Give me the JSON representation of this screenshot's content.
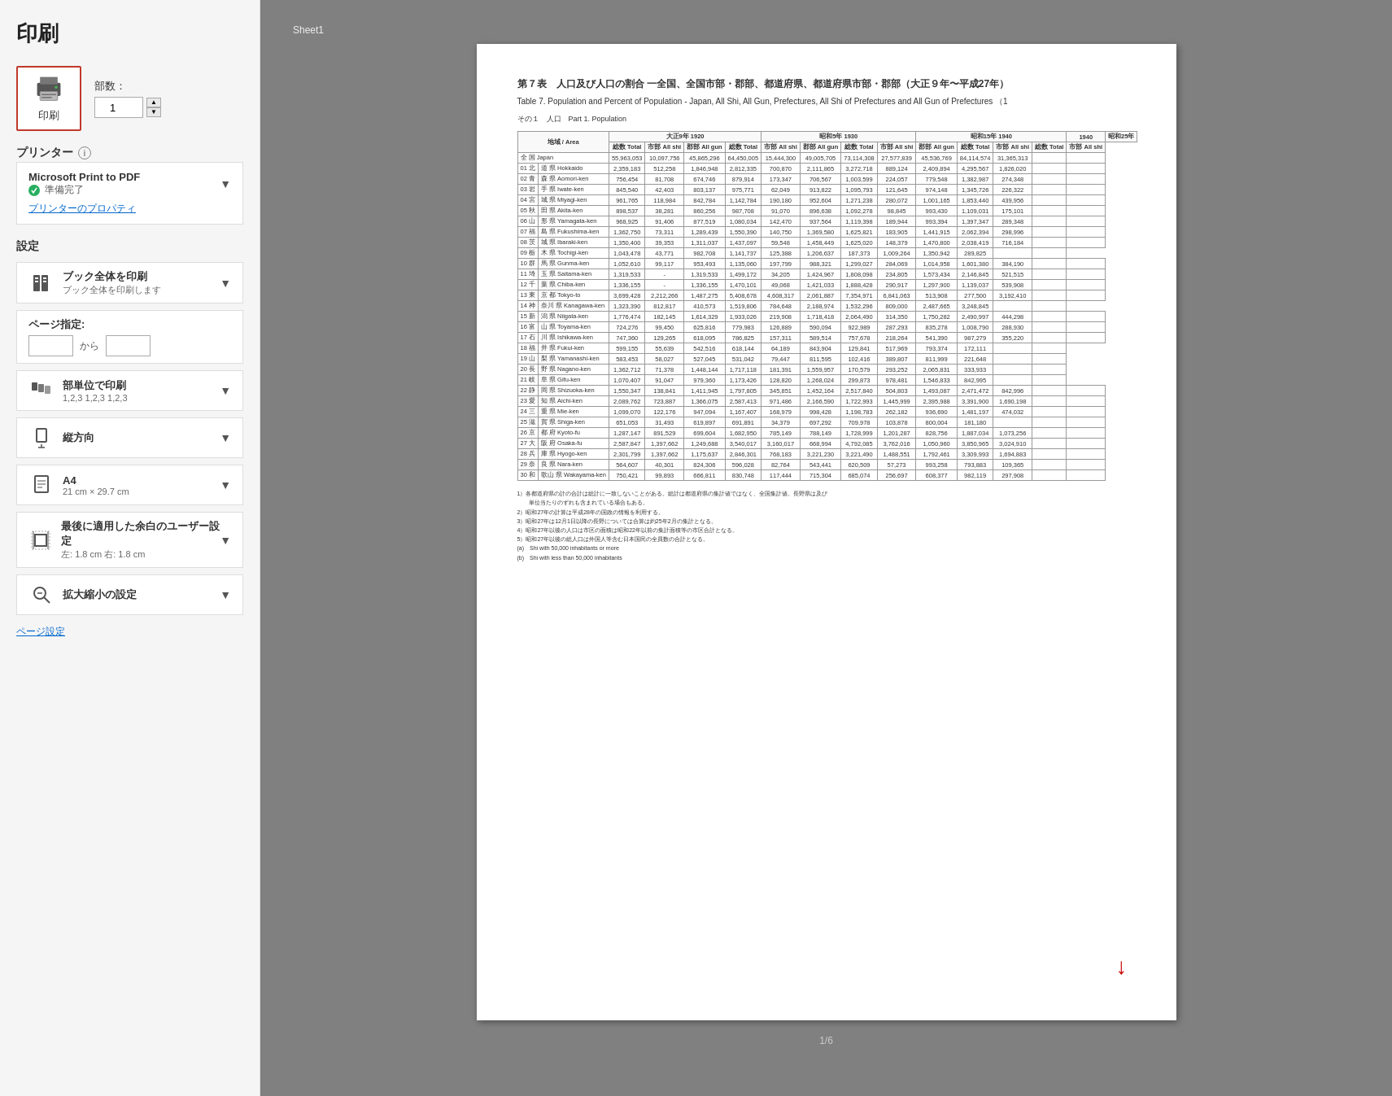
{
  "page": {
    "title": "印刷",
    "print_button_label": "印刷"
  },
  "copies": {
    "label": "部数：",
    "value": "1"
  },
  "printer": {
    "section_label": "プリンター",
    "name": "Microsoft Print to PDF",
    "status": "準備完了",
    "props_link": "プリンターのプロパティ"
  },
  "settings": {
    "section_label": "設定",
    "options": [
      {
        "title": "ブック全体を印刷",
        "subtitle": "ブック全体を印刷します",
        "icon": "book-icon"
      },
      {
        "title": "ページ指定:",
        "subtitle": "",
        "icon": "page-range-icon",
        "from_label": "から",
        "is_page_range": true
      },
      {
        "title": "部単位で印刷",
        "subtitle": "1,2,3  1,2,3  1,2,3",
        "icon": "collate-icon"
      },
      {
        "title": "縦方向",
        "subtitle": "",
        "icon": "portrait-icon"
      },
      {
        "title": "A4",
        "subtitle": "21 cm × 29.7 cm",
        "icon": "paper-icon"
      },
      {
        "title": "最後に適用した余白のユーザー設定",
        "subtitle": "左: 1.8 cm  右: 1.8 cm",
        "icon": "margin-icon"
      }
    ],
    "zoom_label": "拡大縮小の設定",
    "page_setup_link": "ページ設定"
  },
  "preview": {
    "sheet_label": "Sheet1",
    "table_title_jp": "第７表　人口及び人口の割合 一全国、全国市部・郡部、都道府県、都道府県市部・郡部（大正９年〜平成27年）",
    "table_title_en": "Table 7. Population and Percent of Population - Japan, All Shi, All Gun, Prefectures, All Shi of Prefectures and All Gun of Prefectures （1",
    "part_label": "その１　人口　Part 1. Population",
    "page_indicator": "1/6",
    "arrow": "↓"
  }
}
